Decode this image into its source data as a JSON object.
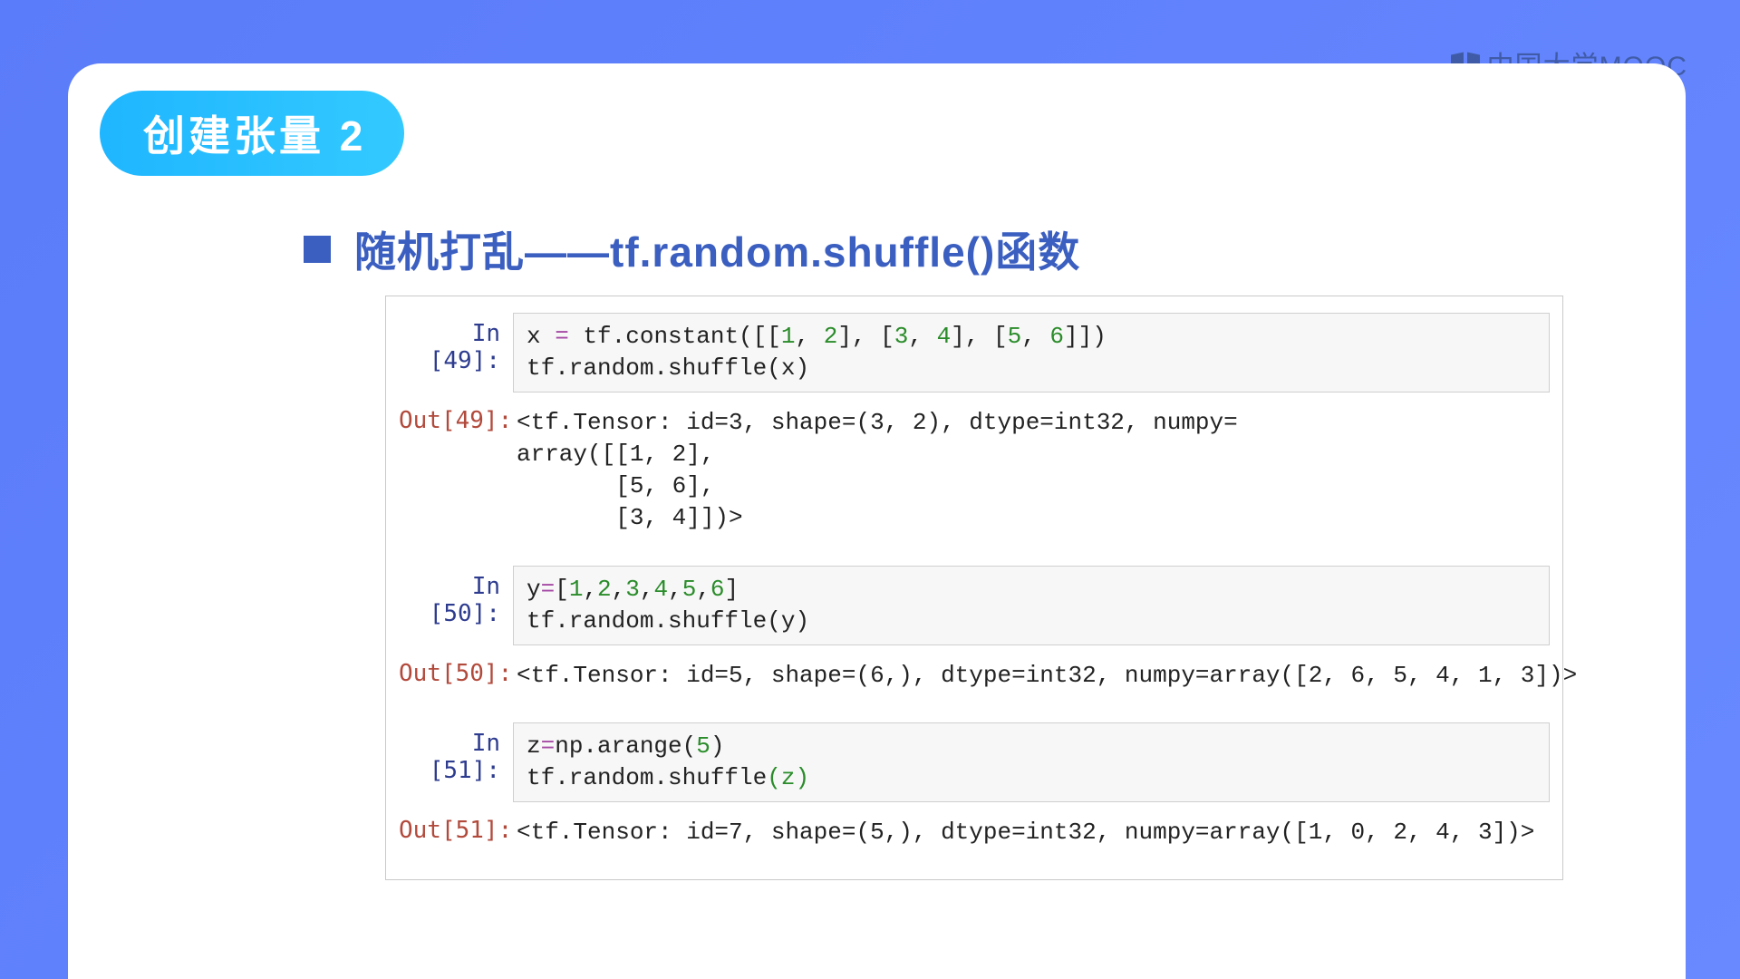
{
  "watermark": "中国大学MOOC",
  "badge": "创建张量 2",
  "heading": "随机打乱——tf.random.shuffle()函数",
  "cells": {
    "in49_prompt": "In [49]:",
    "in49_code_l1_a": "x ",
    "in49_code_l1_eq": "=",
    "in49_code_l1_b": " tf.constant([[",
    "in49_code_l1_n1": "1",
    "in49_code_l1_c": ", ",
    "in49_code_l1_n2": "2",
    "in49_code_l1_d": "], [",
    "in49_code_l1_n3": "3",
    "in49_code_l1_e": ", ",
    "in49_code_l1_n4": "4",
    "in49_code_l1_f": "], [",
    "in49_code_l1_n5": "5",
    "in49_code_l1_g": ", ",
    "in49_code_l1_n6": "6",
    "in49_code_l1_h": "]])",
    "in49_code_l2": "tf.random.shuffle(x)",
    "out49_prompt": "Out[49]:",
    "out49_text": "<tf.Tensor: id=3, shape=(3, 2), dtype=int32, numpy=\narray([[1, 2],\n       [5, 6],\n       [3, 4]])>",
    "in50_prompt": "In [50]:",
    "in50_code_l1_a": "y",
    "in50_code_l1_eq": "=",
    "in50_code_l1_b": "[",
    "in50_code_l1_n1": "1",
    "in50_code_l1_c": ",",
    "in50_code_l1_n2": "2",
    "in50_code_l1_d": ",",
    "in50_code_l1_n3": "3",
    "in50_code_l1_e": ",",
    "in50_code_l1_n4": "4",
    "in50_code_l1_f": ",",
    "in50_code_l1_n5": "5",
    "in50_code_l1_g": ",",
    "in50_code_l1_n6": "6",
    "in50_code_l1_h": "]",
    "in50_code_l2": "tf.random.shuffle(y)",
    "out50_prompt": "Out[50]:",
    "out50_text": "<tf.Tensor: id=5, shape=(6,), dtype=int32, numpy=array([2, 6, 5, 4, 1, 3])>",
    "in51_prompt": "In [51]:",
    "in51_code_l1_a": "z",
    "in51_code_l1_eq": "=",
    "in51_code_l1_b": "np.arange(",
    "in51_code_l1_n1": "5",
    "in51_code_l1_c": ")",
    "in51_code_l2_a": "tf.random.shuffle",
    "in51_code_l2_b": "(z)",
    "out51_prompt": "Out[51]:",
    "out51_text": "<tf.Tensor: id=7, shape=(5,), dtype=int32, numpy=array([1, 0, 2, 4, 3])>"
  }
}
